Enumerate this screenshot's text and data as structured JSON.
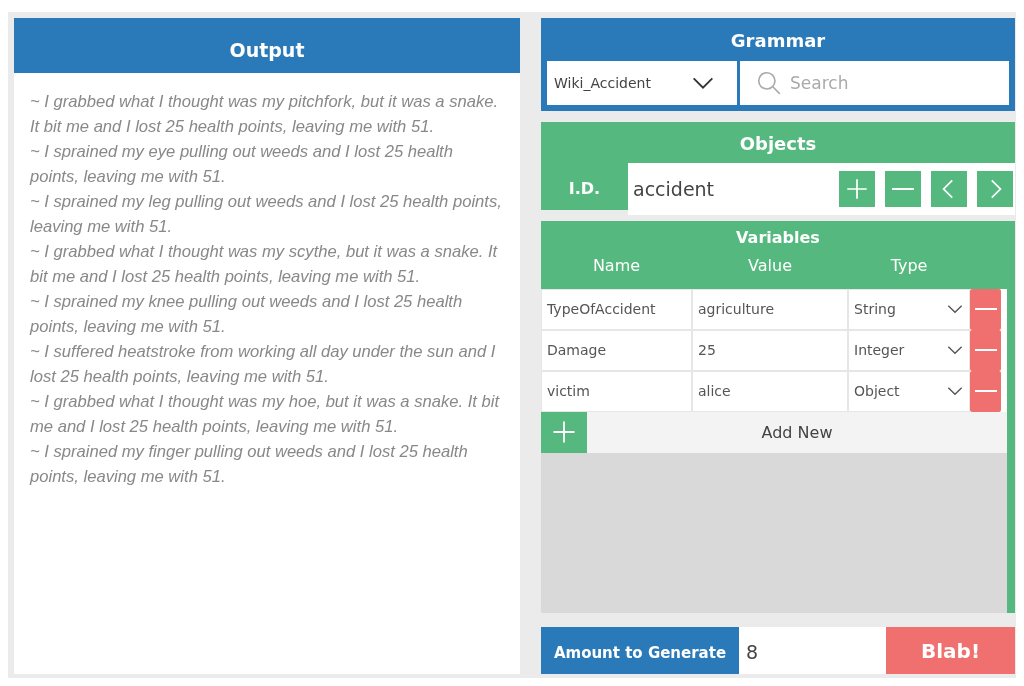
{
  "output": {
    "title": "Output",
    "lines": [
      "~  I grabbed what I thought was my pitchfork, but it was a snake. It bit me and I lost 25 health points, leaving me with 51.",
      "~  I sprained my eye pulling out weeds and I lost 25 health points, leaving me with 51.",
      "~  I sprained my leg pulling out weeds and I lost 25 health points, leaving me with 51.",
      "~  I grabbed what I thought was my scythe, but it was a snake. It bit me and I lost 25 health points, leaving me with 51.",
      "~  I sprained my knee pulling out weeds and I lost 25 health points, leaving me with 51.",
      "~  I suffered heatstroke from working all day under the sun and I lost 25 health points, leaving me with 51.",
      "~  I grabbed what I thought was my hoe, but it was a snake. It bit me and I lost 25 health points, leaving me with 51.",
      "~  I sprained my finger pulling out weeds and I lost 25 health points, leaving me with 51."
    ]
  },
  "grammar": {
    "title": "Grammar",
    "selector": "Wiki_Accident",
    "search": {
      "placeholder": "Search"
    }
  },
  "objects": {
    "title": "Objects",
    "id_label": "I.D.",
    "id_value": "accident",
    "buttons": [
      {
        "kind": "add"
      },
      {
        "kind": "remove"
      },
      {
        "kind": "previous"
      },
      {
        "kind": "next"
      }
    ]
  },
  "variables": {
    "title": "Variables",
    "columns": [
      "Name",
      "Value",
      "Type"
    ],
    "rows": [
      {
        "name": "TypeOfAccident",
        "value": "agriculture",
        "type": "String"
      },
      {
        "name": "Damage",
        "value": "25",
        "type": "Integer"
      },
      {
        "name": "victim",
        "value": "alice",
        "type": "Object"
      }
    ],
    "add_new": "Add New"
  },
  "footer": {
    "amount_label": "Amount to Generate",
    "amount_value": "8",
    "generate_button": "Blab!"
  }
}
